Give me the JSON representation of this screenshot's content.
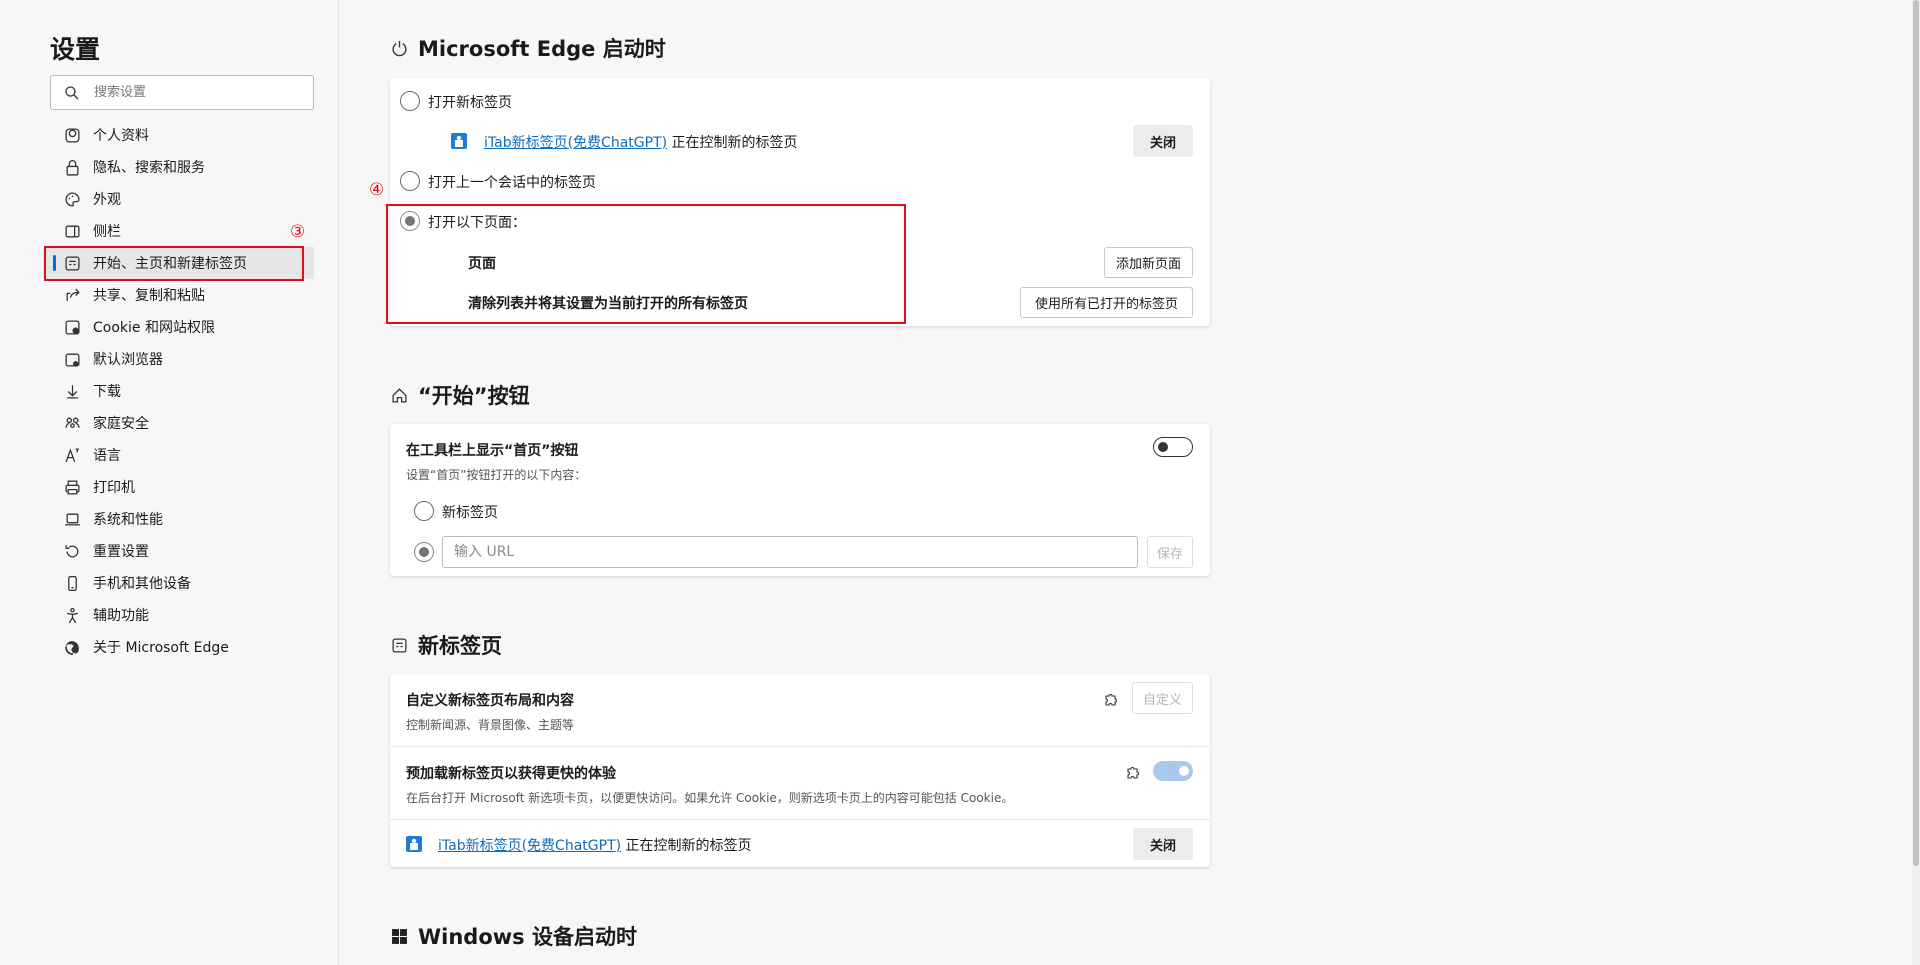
{
  "sidebar": {
    "title": "设置",
    "search_placeholder": "搜索设置",
    "items": [
      {
        "label": "个人资料",
        "icon": "profile-icon"
      },
      {
        "label": "隐私、搜索和服务",
        "icon": "lock-icon"
      },
      {
        "label": "外观",
        "icon": "palette-icon"
      },
      {
        "label": "侧栏",
        "icon": "sidebar-icon"
      },
      {
        "label": "开始、主页和新建标签页",
        "icon": "home-tabs-icon"
      },
      {
        "label": "共享、复制和粘贴",
        "icon": "share-icon"
      },
      {
        "label": "Cookie 和网站权限",
        "icon": "cookie-icon"
      },
      {
        "label": "默认浏览器",
        "icon": "browser-icon"
      },
      {
        "label": "下载",
        "icon": "download-icon"
      },
      {
        "label": "家庭安全",
        "icon": "family-icon"
      },
      {
        "label": "语言",
        "icon": "language-icon"
      },
      {
        "label": "打印机",
        "icon": "printer-icon"
      },
      {
        "label": "系统和性能",
        "icon": "laptop-icon"
      },
      {
        "label": "重置设置",
        "icon": "reset-icon"
      },
      {
        "label": "手机和其他设备",
        "icon": "phone-icon"
      },
      {
        "label": "辅助功能",
        "icon": "accessibility-icon"
      },
      {
        "label": "关于 Microsoft Edge",
        "icon": "edge-icon"
      }
    ],
    "active_index": 4
  },
  "annotations": {
    "nav_marker": "③",
    "startup_marker": "④",
    "color": "#e0101b"
  },
  "startup": {
    "title": "Microsoft Edge 启动时",
    "option_new_tab": "打开新标签页",
    "ext_link": "iTab新标签页(免费ChatGPT)",
    "ext_text": "正在控制新的标签页",
    "close_button": "关闭",
    "option_previous": "打开上一个会话中的标签页",
    "option_pages": "打开以下页面：",
    "pages_label": "页面",
    "add_page_button": "添加新页面",
    "clear_label": "清除列表并将其设置为当前打开的所有标签页",
    "use_all_button": "使用所有已打开的标签页"
  },
  "home_button": {
    "title": "“开始”按钮",
    "toolbar_label": "在工具栏上显示“首页”按钮",
    "toolbar_sub": "设置“首页”按钮打开的以下内容：",
    "toggle_on": false,
    "option_new_tab": "新标签页",
    "url_placeholder": "输入 URL",
    "save_button": "保存"
  },
  "new_tab": {
    "title": "新标签页",
    "customize_label": "自定义新标签页布局和内容",
    "customize_sub": "控制新闻源、背景图像、主题等",
    "customize_button": "自定义",
    "preload_label": "预加载新标签页以获得更快的体验",
    "preload_sub": "在后台打开 Microsoft 新选项卡页，以便更快访问。如果允许 Cookie，则新选项卡页上的内容可能包括 Cookie。",
    "preload_toggle_on": true,
    "ext_link": "iTab新标签页(免费ChatGPT)",
    "ext_text": "正在控制新的标签页",
    "close_button": "关闭"
  },
  "windows_startup": {
    "title": "Windows 设备启动时"
  },
  "colors": {
    "accent": "#0f6cbd",
    "annotation": "#e0101b"
  }
}
